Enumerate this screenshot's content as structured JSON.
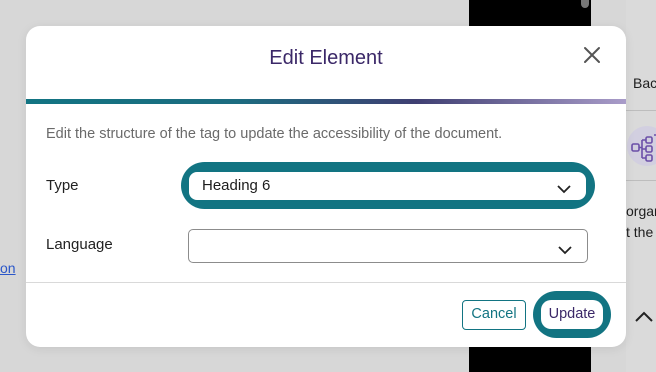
{
  "background": {
    "right_panel": {
      "back_label": "Bac",
      "text_line_1": "orgar",
      "text_line_2": "t the"
    },
    "left_link": "on"
  },
  "dialog": {
    "title": "Edit Element",
    "description": "Edit the structure of the tag to update the accessibility of the document.",
    "fields": {
      "type": {
        "label": "Type",
        "value": "Heading 6"
      },
      "language": {
        "label": "Language",
        "value": ""
      }
    },
    "buttons": {
      "cancel": "Cancel",
      "update": "Update"
    }
  },
  "colors": {
    "accent_teal": "#127482",
    "title_purple": "#3b2868",
    "gradient_end": "#a99cc9"
  },
  "icons": [
    "close-icon",
    "chevron-down-icon",
    "chevron-up-icon",
    "structure-tree-icon"
  ]
}
